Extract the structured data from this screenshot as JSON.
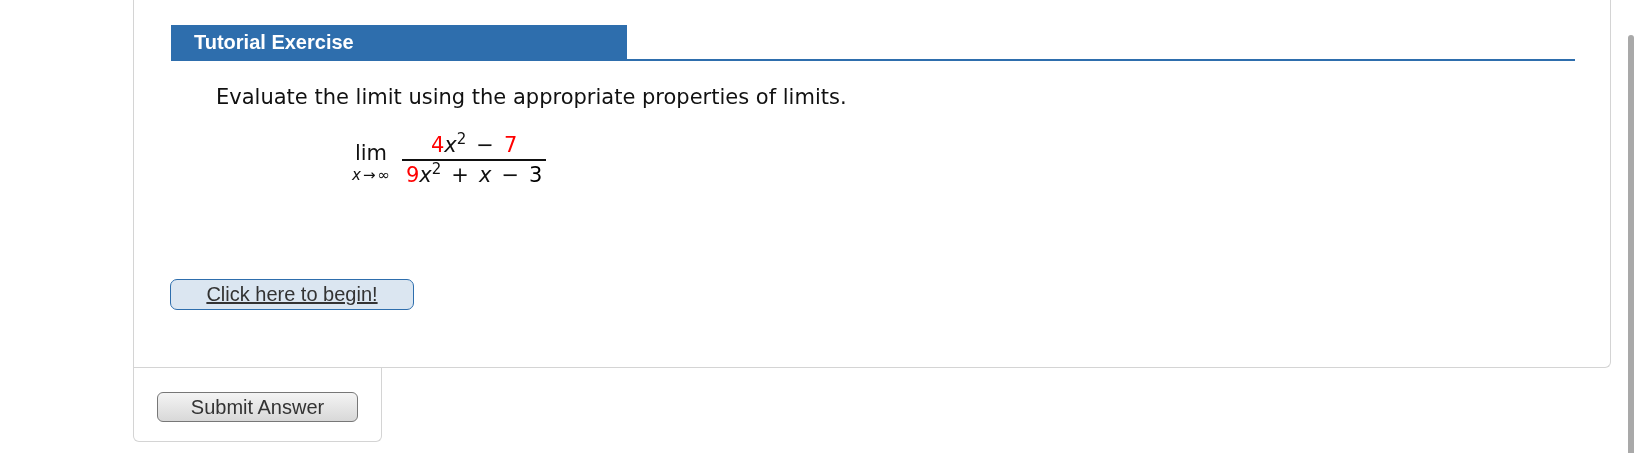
{
  "header": {
    "title": "Tutorial Exercise"
  },
  "instruction": "Evaluate the limit using the appropriate properties of limits.",
  "formula": {
    "operator": "lim",
    "approach": {
      "variable": "x",
      "arrow": "→",
      "target": "∞"
    },
    "numerator": [
      {
        "kind": "num",
        "text": "4",
        "color": "#ff0000"
      },
      {
        "kind": "var",
        "text": "x",
        "sup": "2"
      },
      {
        "kind": "op",
        "text": "−"
      },
      {
        "kind": "num",
        "text": "7",
        "color": "#ff0000"
      }
    ],
    "denominator": [
      {
        "kind": "num",
        "text": "9",
        "color": "#ff0000"
      },
      {
        "kind": "var",
        "text": "x",
        "sup": "2"
      },
      {
        "kind": "op",
        "text": "+"
      },
      {
        "kind": "var",
        "text": "x"
      },
      {
        "kind": "op",
        "text": "−"
      },
      {
        "kind": "num",
        "text": "3",
        "color": "#000000"
      }
    ]
  },
  "begin_button": "Click here to begin!",
  "submit_button": "Submit Answer"
}
